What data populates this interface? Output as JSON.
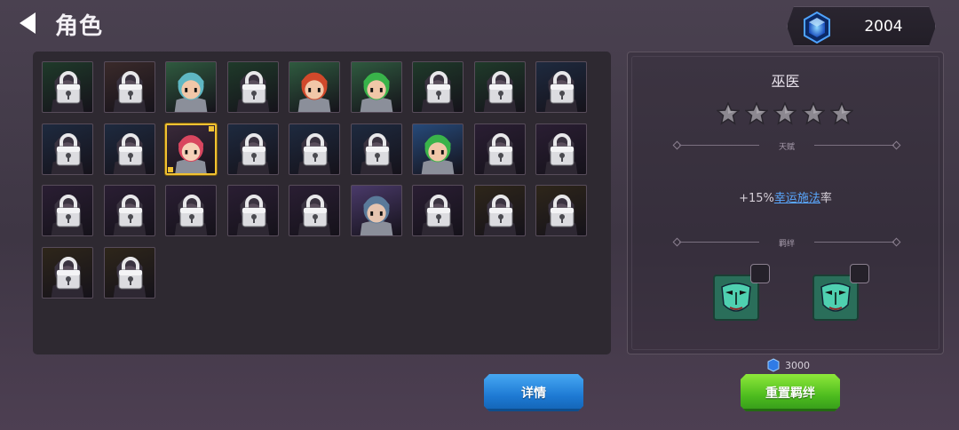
{
  "header": {
    "title": "角色",
    "back_icon": "back-arrow-icon",
    "currency": {
      "icon": "blue-gem-icon",
      "amount": "2004"
    }
  },
  "grid": {
    "slots": [
      {
        "row": 0,
        "col": 0,
        "locked": true,
        "tint": "#1f3a2a"
      },
      {
        "row": 0,
        "col": 1,
        "locked": true,
        "tint": "#3a2a2a"
      },
      {
        "row": 0,
        "col": 2,
        "locked": false,
        "tint": "#2f5a3f",
        "hair": "#5fb7c3",
        "face": "#f1c7a8"
      },
      {
        "row": 0,
        "col": 3,
        "locked": true,
        "tint": "#1f3a2a"
      },
      {
        "row": 0,
        "col": 4,
        "locked": false,
        "tint": "#2f5a3f",
        "hair": "#d1492b",
        "face": "#f1c7a8"
      },
      {
        "row": 0,
        "col": 5,
        "locked": false,
        "tint": "#2f5a3f",
        "hair": "#39b34a",
        "face": "#f1c7a8"
      },
      {
        "row": 0,
        "col": 6,
        "locked": true,
        "tint": "#1f3a2a"
      },
      {
        "row": 0,
        "col": 7,
        "locked": true,
        "tint": "#1f3a2a"
      },
      {
        "row": 0,
        "col": 8,
        "locked": true,
        "tint": "#1e2a3f"
      },
      {
        "row": 1,
        "col": 0,
        "locked": true,
        "tint": "#1e2a3f"
      },
      {
        "row": 1,
        "col": 1,
        "locked": true,
        "tint": "#1e2a3f"
      },
      {
        "row": 1,
        "col": 2,
        "locked": false,
        "selected": true,
        "tint": "#3a2a3a",
        "hair": "#d9465f",
        "face": "#f6d1b8"
      },
      {
        "row": 1,
        "col": 3,
        "locked": true,
        "tint": "#1e2a3f"
      },
      {
        "row": 1,
        "col": 4,
        "locked": true,
        "tint": "#1e2a3f"
      },
      {
        "row": 1,
        "col": 5,
        "locked": true,
        "tint": "#1e2a3f"
      },
      {
        "row": 1,
        "col": 6,
        "locked": false,
        "tint": "#264a7a",
        "hair": "#3ab34a",
        "face": "#f1c7a8"
      },
      {
        "row": 1,
        "col": 7,
        "locked": true,
        "tint": "#2a1e33"
      },
      {
        "row": 1,
        "col": 8,
        "locked": true,
        "tint": "#2a1e33"
      },
      {
        "row": 2,
        "col": 0,
        "locked": true,
        "tint": "#2a1e33"
      },
      {
        "row": 2,
        "col": 1,
        "locked": true,
        "tint": "#2a1e33"
      },
      {
        "row": 2,
        "col": 2,
        "locked": true,
        "tint": "#2a1e33"
      },
      {
        "row": 2,
        "col": 3,
        "locked": true,
        "tint": "#2a1e33"
      },
      {
        "row": 2,
        "col": 4,
        "locked": true,
        "tint": "#2a1e33"
      },
      {
        "row": 2,
        "col": 5,
        "locked": false,
        "tint": "#4a3a6a",
        "hair": "#5a7a9a",
        "face": "#e6c5b0"
      },
      {
        "row": 2,
        "col": 6,
        "locked": true,
        "tint": "#2a1e33"
      },
      {
        "row": 2,
        "col": 7,
        "locked": true,
        "tint": "#2e261a"
      },
      {
        "row": 2,
        "col": 8,
        "locked": true,
        "tint": "#2e261a"
      },
      {
        "row": 3,
        "col": 0,
        "locked": true,
        "tint": "#2e261a"
      },
      {
        "row": 3,
        "col": 1,
        "locked": true,
        "tint": "#2e261a"
      }
    ]
  },
  "info": {
    "name": "巫医",
    "stars": {
      "filled": 0,
      "total": 5,
      "icon": "star-icon"
    },
    "talent_label": "天赋",
    "talent_prefix": "+15%",
    "talent_link": "幸运施法",
    "talent_suffix": "率",
    "bond_label": "羁绊",
    "bond_items": [
      {
        "icon": "mask-icon"
      },
      {
        "icon": "mask-icon"
      }
    ]
  },
  "actions": {
    "cost_icon": "blue-gem-icon",
    "cost": "3000",
    "details_label": "详情",
    "reset_bond_label": "重置羁绊"
  },
  "colors": {
    "accent_blue": "#1d79d3",
    "accent_green": "#4cbb1e",
    "selected_border": "#f1c232",
    "link": "#5aa8ff"
  }
}
